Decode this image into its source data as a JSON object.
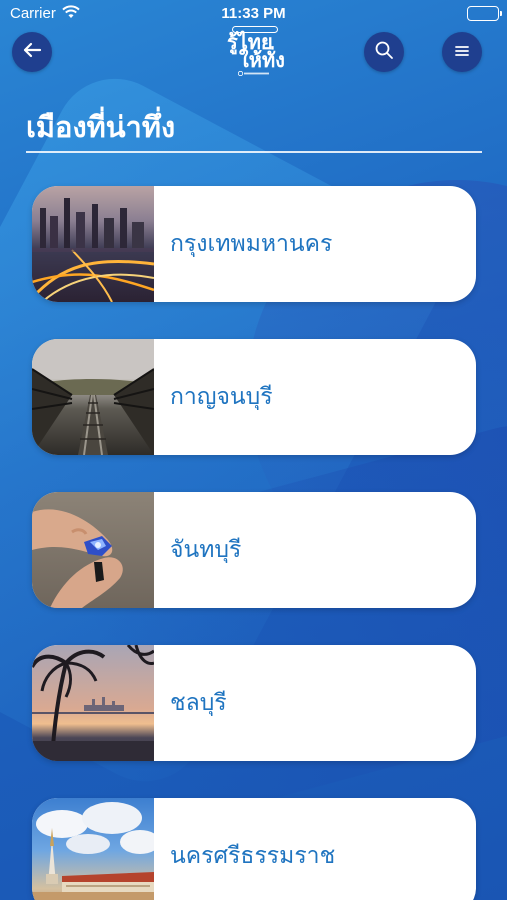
{
  "status_bar": {
    "carrier": "Carrier",
    "time": "11:33 PM"
  },
  "header": {
    "back_icon": "arrow-left-icon",
    "search_icon": "search-icon",
    "menu_icon": "hamburger-menu-icon",
    "logo": {
      "line1": "รู้ไทย",
      "line2": "ให้ทั่ง"
    }
  },
  "page": {
    "title": "เมืองที่น่าทึ่ง"
  },
  "cities": [
    {
      "name": "กรุงเทพมหานคร",
      "image": "bangkok-night-skyline-photo"
    },
    {
      "name": "กาญจนบุรี",
      "image": "railway-bridge-photo"
    },
    {
      "name": "จันทบุรี",
      "image": "sapphire-gem-in-hands-photo"
    },
    {
      "name": "ชลบุรี",
      "image": "palm-beach-sunset-photo"
    },
    {
      "name": "นครศรีธรรมราช",
      "image": "temple-pagoda-photo"
    }
  ],
  "colors": {
    "background": "#1f6fc4",
    "button": "#1f3f8f",
    "card": "#ffffff",
    "city_text": "#1f74c0"
  }
}
